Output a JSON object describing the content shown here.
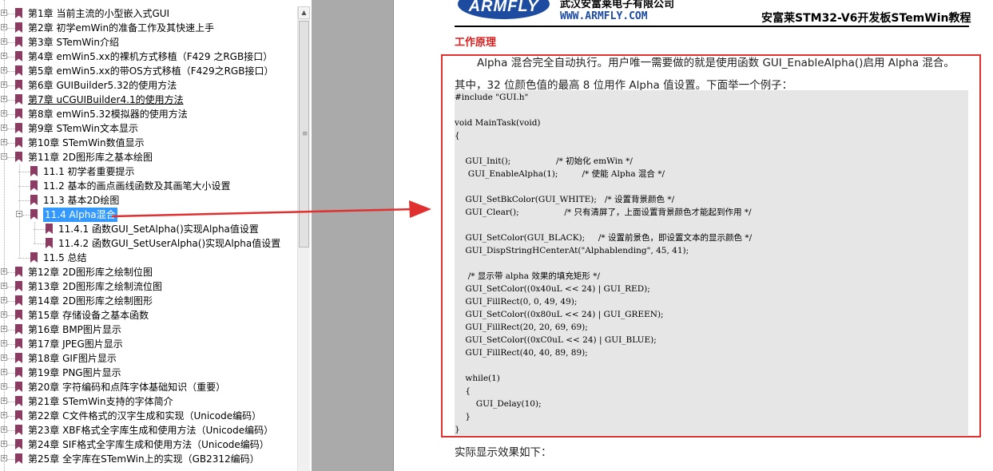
{
  "sidebar": {
    "items": [
      {
        "label": "第1章 当前主流的小型嵌入式GUI",
        "level": 0,
        "expandable": true
      },
      {
        "label": "第2章 初学emWin的准备工作及其快速上手",
        "level": 0,
        "expandable": true
      },
      {
        "label": "第3章 STemWin介绍",
        "level": 0,
        "expandable": true
      },
      {
        "label": "第4章 emWin5.xx的裸机方式移植（F429 之RGB接口）",
        "level": 0,
        "expandable": true
      },
      {
        "label": "第5章 emWin5.xx的带OS方式移植（F429之RGB接口）",
        "level": 0,
        "expandable": true
      },
      {
        "label": "第6章 GUIBuilder5.32的使用方法",
        "level": 0,
        "expandable": true
      },
      {
        "label": "第7章 uCGUIBuilder4.1的使用方法",
        "level": 0,
        "expandable": true,
        "underlined": true
      },
      {
        "label": "第8章 emWin5.32模拟器的使用方法",
        "level": 0,
        "expandable": true
      },
      {
        "label": "第9章 STemWin文本显示",
        "level": 0,
        "expandable": true
      },
      {
        "label": "第10章 STemWin数值显示",
        "level": 0,
        "expandable": true
      },
      {
        "label": "第11章 2D图形库之基本绘图",
        "level": 0,
        "expandable": true,
        "expanded": true
      },
      {
        "label": "11.1 初学者重要提示",
        "level": 1,
        "expandable": false
      },
      {
        "label": "11.2 基本的画点画线函数及其画笔大小设置",
        "level": 1,
        "expandable": false
      },
      {
        "label": "11.3 基本2D绘图",
        "level": 1,
        "expandable": false
      },
      {
        "label": "11.4 Alpha混合",
        "level": 1,
        "expandable": true,
        "expanded": true,
        "selected": true
      },
      {
        "label": "11.4.1 函数GUI_SetAlpha()实现Alpha值设置",
        "level": 2,
        "expandable": false
      },
      {
        "label": "11.4.2 函数GUI_SetUserAlpha()实现Alpha值设置",
        "level": 2,
        "expandable": false
      },
      {
        "label": "11.5 总结",
        "level": 1,
        "expandable": false
      },
      {
        "label": "第12章 2D图形库之绘制位图",
        "level": 0,
        "expandable": true
      },
      {
        "label": "第13章 2D图形库之绘制流位图",
        "level": 0,
        "expandable": true
      },
      {
        "label": "第14章 2D图形库之绘制图形",
        "level": 0,
        "expandable": true
      },
      {
        "label": "第15章 存储设备之基本函数",
        "level": 0,
        "expandable": true
      },
      {
        "label": "第16章 BMP图片显示",
        "level": 0,
        "expandable": true
      },
      {
        "label": "第17章 JPEG图片显示",
        "level": 0,
        "expandable": true
      },
      {
        "label": "第18章 GIF图片显示",
        "level": 0,
        "expandable": true
      },
      {
        "label": "第19章 PNG图片显示",
        "level": 0,
        "expandable": true
      },
      {
        "label": "第20章 字符编码和点阵字体基础知识（重要）",
        "level": 0,
        "expandable": true
      },
      {
        "label": "第21章 STemWin支持的字体简介",
        "level": 0,
        "expandable": true
      },
      {
        "label": "第22章 C文件格式的汉字生成和实现（Unicode编码）",
        "level": 0,
        "expandable": true
      },
      {
        "label": "第23章 XBF格式全字库生成和使用方法（Unicode编码）",
        "level": 0,
        "expandable": true
      },
      {
        "label": "第24章 SIF格式全字库生成和使用方法（Unicode编码）",
        "level": 0,
        "expandable": true
      },
      {
        "label": "第25章 全字库在STemWin上的实现（GB2312编码）",
        "level": 0,
        "expandable": true
      }
    ]
  },
  "doc": {
    "logo_text": "ARMFLY",
    "company_name": "武汉安富莱电子有限公司",
    "website": "WWW.ARMFLY.COM",
    "doc_title": "安富莱STM32-V6开发板STemWin教程",
    "section_heading": "工作原理",
    "paragraph_line1": "Alpha 混合完全自动执行。用户唯一需要做的就是使用函数 GUI_EnableAlpha()启用 Alpha 混合。",
    "paragraph_line2": "其中，32 位颜色值的最高 8 位用作 Alpha 值设置。下面举一个例子：",
    "code_lines": [
      "#include \"GUI.h\"",
      "",
      "void MainTask(void)",
      "{",
      "",
      "    GUI_Init();                 /* 初始化 emWin */",
      "     GUI_EnableAlpha(1);         /* 使能 Alpha 混合 */",
      "",
      "    GUI_SetBkColor(GUI_WHITE);   /* 设置背景颜色 */",
      "    GUI_Clear();                 /* 只有清屏了，上面设置背景颜色才能起到作用 */",
      "",
      "    GUI_SetColor(GUI_BLACK);     /* 设置前景色，即设置文本的显示颜色 */",
      "    GUI_DispStringHCenterAt(\"Alphablending\", 45, 41);",
      "",
      "     /* 显示带 alpha 效果的填充矩形 */",
      "    GUI_SetColor((0x40uL << 24) | GUI_RED);",
      "    GUI_FillRect(0, 0, 49, 49);",
      "    GUI_SetColor((0x80uL << 24) | GUI_GREEN);",
      "    GUI_FillRect(20, 20, 69, 69);",
      "    GUI_SetColor((0xC0uL << 24) | GUI_BLUE);",
      "    GUI_FillRect(40, 40, 89, 89);",
      "",
      "    while(1)",
      "    {",
      "        GUI_Delay(10);",
      "    }",
      "}"
    ],
    "after_text": "实际显示效果如下："
  },
  "colors": {
    "selection": "#3399ff",
    "bookmark": "#8c3b63",
    "annotation_red": "#e03030",
    "heading_red": "#d81e1e",
    "logo_blue": "#1c4ba0",
    "gutter": "#aaaaaa",
    "code_bg": "#e6e6e6"
  },
  "icons": {
    "bookmark": "bookmark-ribbon-icon",
    "expand": "plus-box-icon",
    "collapse": "minus-box-icon"
  }
}
